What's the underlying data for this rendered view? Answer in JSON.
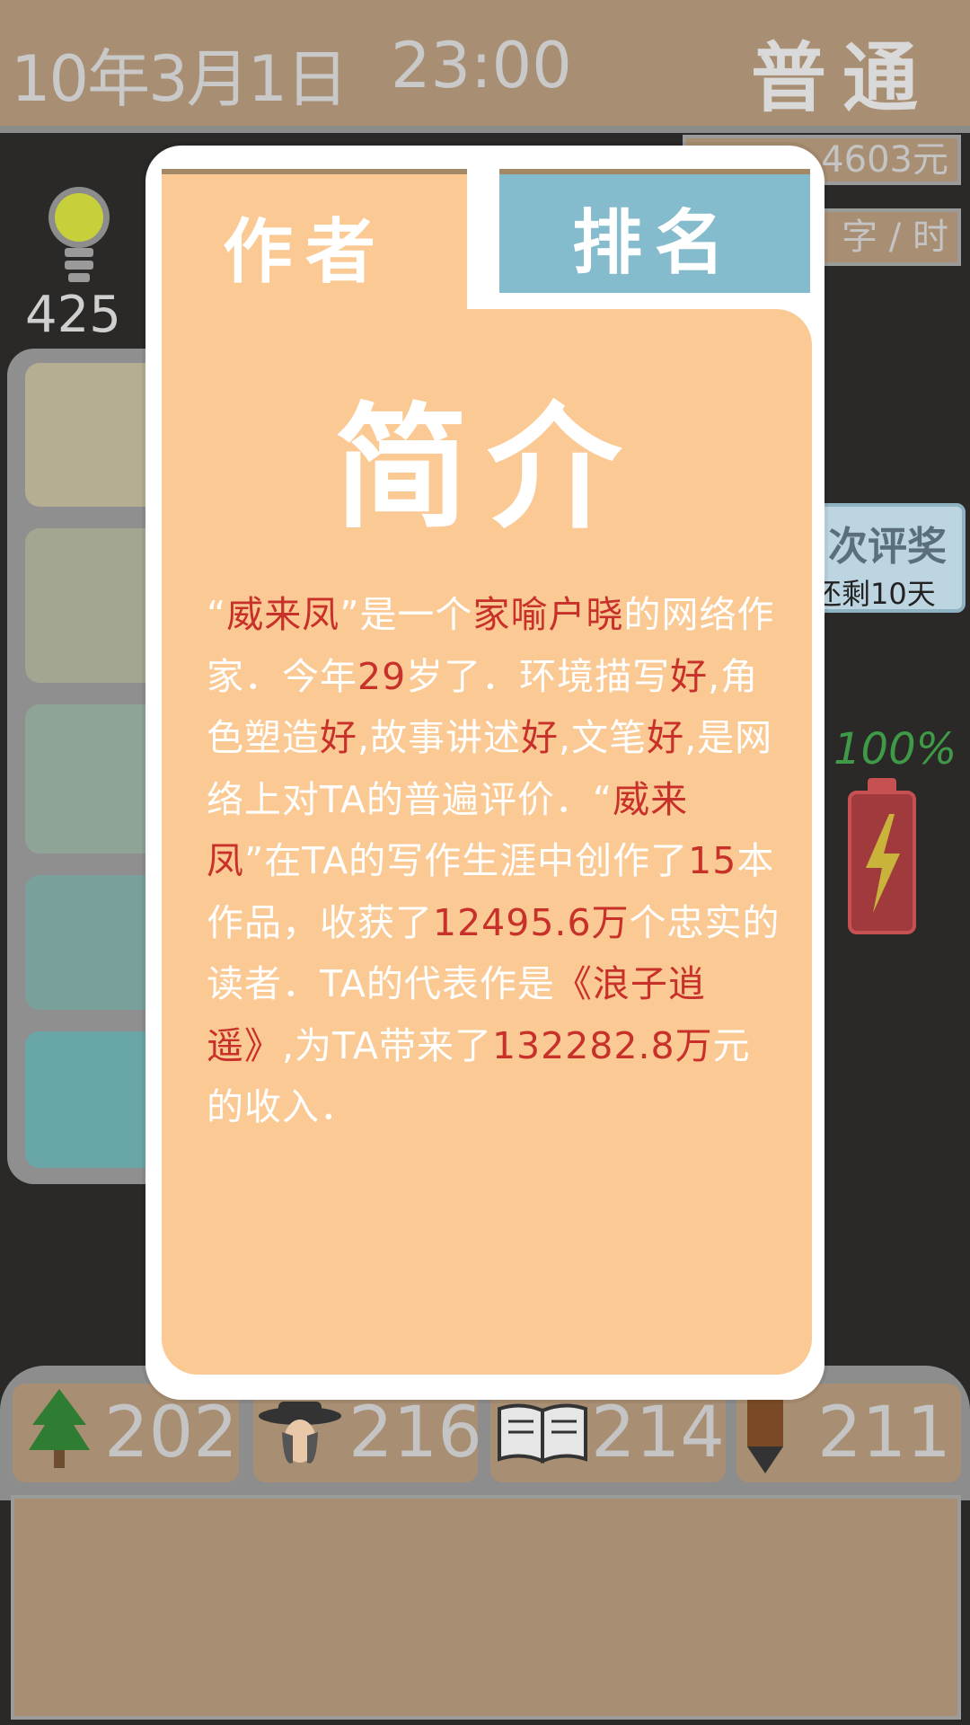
{
  "status_bar": {
    "date": "10年3月1日",
    "time": "23:00",
    "difficulty": "普通"
  },
  "right_chips": {
    "money": "4603元",
    "speed": "字 / 时"
  },
  "idea": {
    "icon": "lightbulb-icon",
    "count": "425"
  },
  "award": {
    "title": "次评奖",
    "countdown": "还剩10天"
  },
  "battery": {
    "percent": "100%",
    "icon": "lightning-icon",
    "color": "#a13a3d"
  },
  "stats": [
    {
      "icon": "tree-icon",
      "value": "202"
    },
    {
      "icon": "character-icon",
      "value": "216"
    },
    {
      "icon": "book-icon",
      "value": "214"
    },
    {
      "icon": "pencil-icon",
      "value": "211"
    }
  ],
  "modal": {
    "tabs": [
      {
        "label": "作者",
        "active": true,
        "color": "#fbc993"
      },
      {
        "label": "排名",
        "active": false,
        "color": "#84bccd"
      }
    ],
    "title": "简介",
    "bio": {
      "s1": "“",
      "name1": "威来凤",
      "s2": "”是一个",
      "fame": "家喻户晓",
      "s3": "的网络作家．今年",
      "age": "29",
      "s4": "岁了．环境描写",
      "g1": "好",
      "s5": ",角色塑造",
      "g2": "好",
      "s6": ",故事讲述",
      "g3": "好",
      "s7": ",文笔",
      "g4": "好",
      "s8": ",是网络上对TA的普遍评价．“",
      "name2": "威来凤",
      "s9": "”在TA的写作生涯中创作了",
      "works": "15",
      "s10": "本作品，收获了",
      "readers": "12495.6万",
      "s11": "个忠实的读者．TA的代表作是",
      "masterpiece": "《浪子逍遥》",
      "s12": ",为TA带来了",
      "income": "132282.8万",
      "s13": "元的收入．"
    },
    "accent": "#c8302a"
  }
}
